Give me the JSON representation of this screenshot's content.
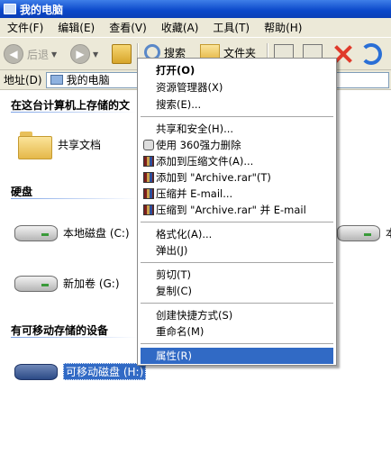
{
  "window": {
    "title": "我的电脑"
  },
  "menubar": {
    "items": [
      "文件(F)",
      "编辑(E)",
      "查看(V)",
      "收藏(A)",
      "工具(T)",
      "帮助(H)"
    ]
  },
  "toolbar": {
    "back_label": "后退",
    "search_label": "搜索",
    "folders_label": "文件夹"
  },
  "addressbar": {
    "label": "地址(D)",
    "value": "我的电脑"
  },
  "sections": {
    "stored_files": "在这台计算机上存储的文",
    "hard_disks": "硬盘",
    "removable": "有可移动存储的设备"
  },
  "items": {
    "shared_docs": "共享文档",
    "local_disk_c": "本地磁盘 (C:)",
    "new_volume_g": "新加卷 (G:)",
    "removable_h": "可移动磁盘 (H:)",
    "right_disk_partial": "本"
  },
  "context_menu": {
    "items": [
      {
        "label": "打开(O)",
        "bold": true
      },
      {
        "label": "资源管理器(X)"
      },
      {
        "label": "搜索(E)..."
      },
      {
        "label": "共享和安全(H)..."
      },
      {
        "label": "使用 360强力删除",
        "icon": "delete-icon"
      },
      {
        "label": "添加到压缩文件(A)...",
        "icon": "rar-icon"
      },
      {
        "label": "添加到 \"Archive.rar\"(T)",
        "icon": "rar-icon"
      },
      {
        "label": "压缩并 E-mail...",
        "icon": "rar-icon"
      },
      {
        "label": "压缩到 \"Archive.rar\" 并 E-mail",
        "icon": "rar-icon"
      },
      {
        "label": "格式化(A)..."
      },
      {
        "label": "弹出(J)"
      },
      {
        "label": "剪切(T)"
      },
      {
        "label": "复制(C)"
      },
      {
        "label": "创建快捷方式(S)"
      },
      {
        "label": "重命名(M)"
      },
      {
        "label": "属性(R)",
        "highlighted": true
      }
    ]
  },
  "colors": {
    "titlebar": "#0a47c9",
    "highlight": "#316ac5",
    "chrome": "#ece9d8"
  }
}
